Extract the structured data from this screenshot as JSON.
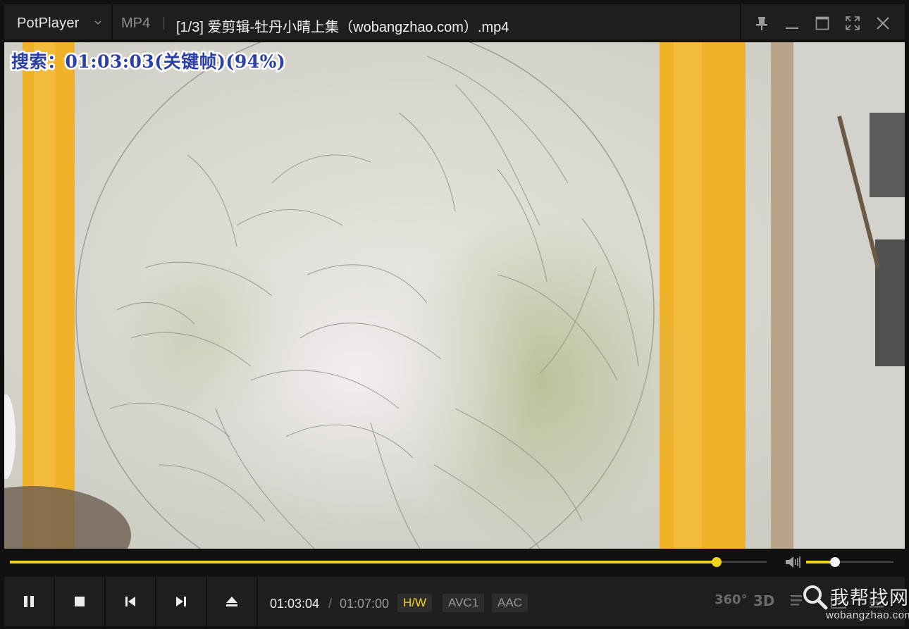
{
  "app": {
    "name": "PotPlayer"
  },
  "title_bar": {
    "format": "MP4",
    "file_title": "[1/3] 爱剪辑-牡丹小晴上集（wobangzhao.com）.mp4"
  },
  "video": {
    "osd_text": "搜索：01:03:03(关键帧)(94%)"
  },
  "playback": {
    "seek_progress": 0.934,
    "volume_level": 0.33
  },
  "controls": {
    "current_time": "01:03:04",
    "separator": "/",
    "total_time": "01:07:00",
    "badges": {
      "hw": "H/W",
      "video_codec": "AVC1",
      "audio_codec": "AAC"
    },
    "icons": {
      "vr": "360°",
      "stereo": "3D"
    }
  },
  "watermark": {
    "main": "我帮找网",
    "sub": "wobangzhao.com"
  },
  "colors": {
    "accent": "#f2d21a",
    "osd_text": "#2a3fa8",
    "panel": "#1e1e1e",
    "background": "#111111"
  }
}
